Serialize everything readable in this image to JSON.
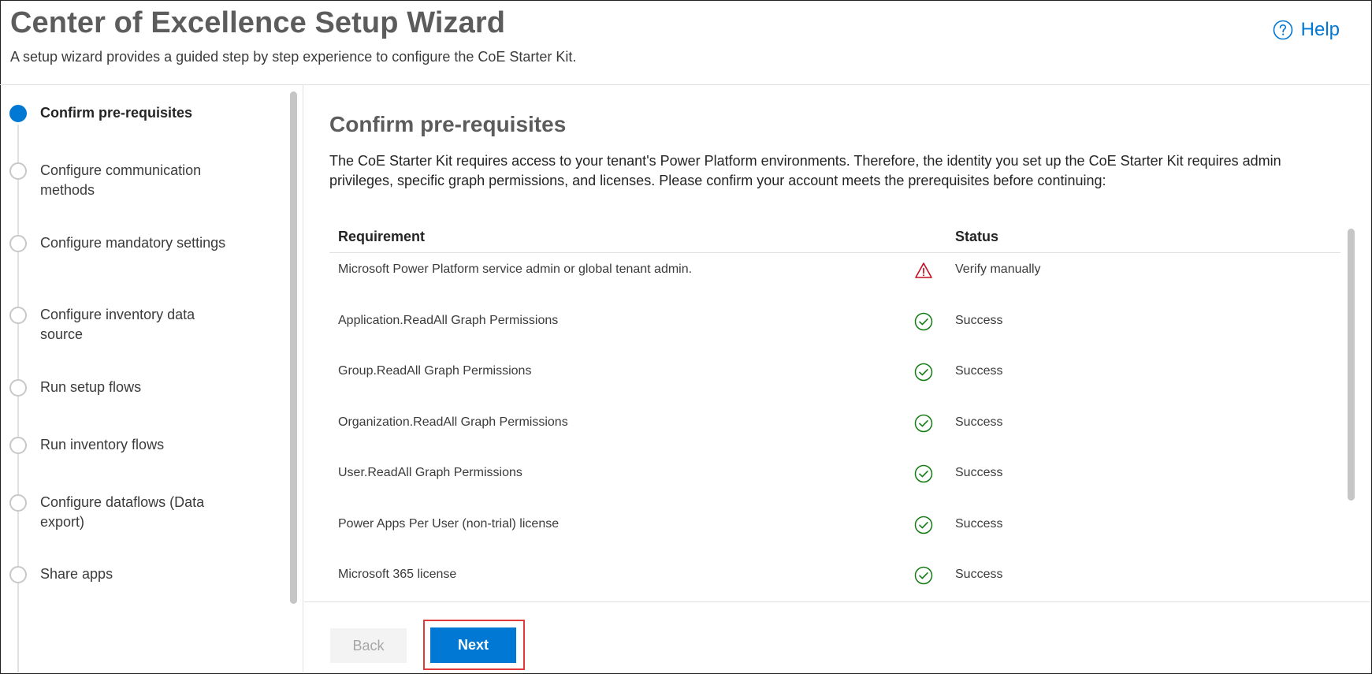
{
  "header": {
    "title": "Center of Excellence Setup Wizard",
    "subtitle": "A setup wizard provides a guided step by step experience to configure the CoE Starter Kit.",
    "help_label": "Help"
  },
  "sidebar": {
    "steps": [
      {
        "label": "Confirm pre-requisites",
        "active": true
      },
      {
        "label": "Configure communication methods",
        "active": false
      },
      {
        "label": "Configure mandatory settings",
        "active": false
      },
      {
        "label": "Configure inventory data source",
        "active": false
      },
      {
        "label": "Run setup flows",
        "active": false
      },
      {
        "label": "Run inventory flows",
        "active": false
      },
      {
        "label": "Configure dataflows (Data export)",
        "active": false
      },
      {
        "label": "Share apps",
        "active": false
      }
    ]
  },
  "main": {
    "heading": "Confirm pre-requisites",
    "intro": "The CoE Starter Kit requires access to your tenant's Power Platform environments. Therefore, the identity you set up the CoE Starter Kit requires admin privileges, specific graph permissions, and licenses. Please confirm your account meets the prerequisites before continuing:",
    "table": {
      "headers": {
        "requirement": "Requirement",
        "status": "Status"
      },
      "rows": [
        {
          "requirement": "Microsoft Power Platform service admin or global tenant admin.",
          "status": "Verify manually",
          "icon": "warning-icon"
        },
        {
          "requirement": "Application.ReadAll Graph Permissions",
          "status": "Success",
          "icon": "success-check-icon"
        },
        {
          "requirement": "Group.ReadAll Graph Permissions",
          "status": "Success",
          "icon": "success-check-icon"
        },
        {
          "requirement": "Organization.ReadAll Graph Permissions",
          "status": "Success",
          "icon": "success-check-icon"
        },
        {
          "requirement": "User.ReadAll Graph Permissions",
          "status": "Success",
          "icon": "success-check-icon"
        },
        {
          "requirement": "Power Apps Per User (non-trial) license",
          "status": "Success",
          "icon": "success-check-icon"
        },
        {
          "requirement": "Microsoft 365 license",
          "status": "Success",
          "icon": "success-check-icon"
        }
      ]
    }
  },
  "footer": {
    "back_label": "Back",
    "next_label": "Next"
  },
  "colors": {
    "accent": "#0078d4",
    "success": "#107c10",
    "warning": "#c50f1f",
    "highlight": "#e03a3a"
  }
}
